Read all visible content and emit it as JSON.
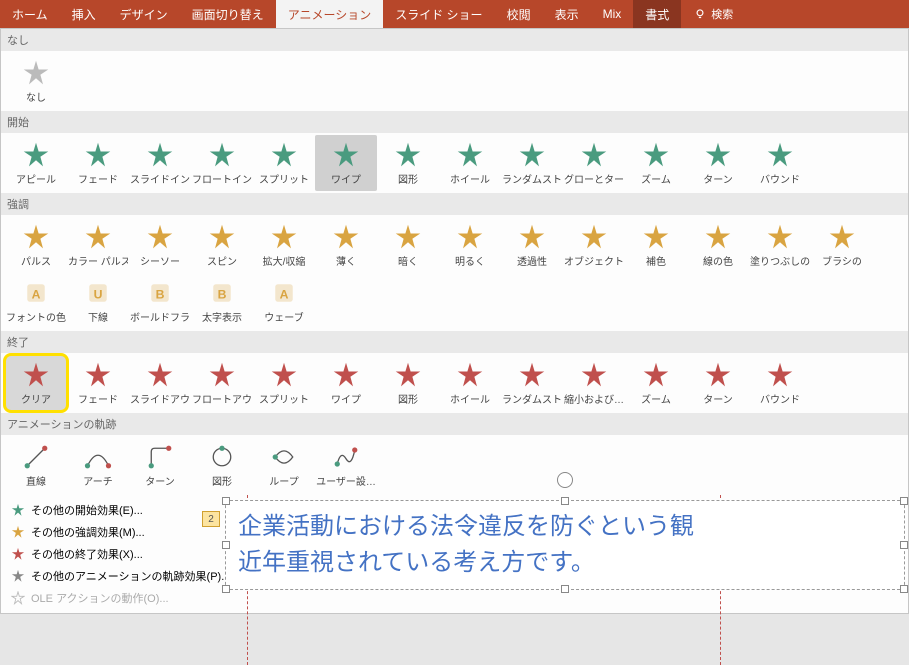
{
  "ribbon": {
    "tabs": [
      "ホーム",
      "挿入",
      "デザイン",
      "画面切り替え",
      "アニメーション",
      "スライド ショー",
      "校閲",
      "表示",
      "Mix",
      "書式"
    ],
    "active": "アニメーション",
    "dark": "書式",
    "search": "検索"
  },
  "sections": {
    "none": {
      "label": "なし",
      "items": [
        {
          "label": "なし",
          "color": "#bbb"
        }
      ]
    },
    "entrance": {
      "label": "開始",
      "items": [
        {
          "label": "アピール",
          "color": "#4a9b7f"
        },
        {
          "label": "フェード",
          "color": "#4a9b7f"
        },
        {
          "label": "スライドイン",
          "color": "#4a9b7f"
        },
        {
          "label": "フロートイン",
          "color": "#4a9b7f"
        },
        {
          "label": "スプリット",
          "color": "#4a9b7f"
        },
        {
          "label": "ワイプ",
          "color": "#4a9b7f",
          "hovered": true
        },
        {
          "label": "図形",
          "color": "#4a9b7f"
        },
        {
          "label": "ホイール",
          "color": "#4a9b7f"
        },
        {
          "label": "ランダムスト…",
          "color": "#4a9b7f"
        },
        {
          "label": "グローとターン",
          "color": "#4a9b7f"
        },
        {
          "label": "ズーム",
          "color": "#4a9b7f"
        },
        {
          "label": "ターン",
          "color": "#4a9b7f"
        },
        {
          "label": "バウンド",
          "color": "#4a9b7f"
        }
      ]
    },
    "emphasis": {
      "label": "強調",
      "items": [
        {
          "label": "パルス",
          "color": "#d9a441"
        },
        {
          "label": "カラー パルス",
          "color": "#d9a441"
        },
        {
          "label": "シーソー",
          "color": "#d9a441"
        },
        {
          "label": "スピン",
          "color": "#d9a441"
        },
        {
          "label": "拡大/収縮",
          "color": "#d9a441"
        },
        {
          "label": "薄く",
          "color": "#d9a441"
        },
        {
          "label": "暗く",
          "color": "#d9a441"
        },
        {
          "label": "明るく",
          "color": "#d9a441"
        },
        {
          "label": "透過性",
          "color": "#d9a441"
        },
        {
          "label": "オブジェクト …",
          "color": "#d9a441"
        },
        {
          "label": "補色",
          "color": "#d9a441"
        },
        {
          "label": "線の色",
          "color": "#d9a441"
        },
        {
          "label": "塗りつぶしの色",
          "color": "#d9a441"
        },
        {
          "label": "ブラシの",
          "color": "#d9a441"
        },
        {
          "label": "フォントの色",
          "color": "#d9a441",
          "letter": "A"
        },
        {
          "label": "下線",
          "color": "#d9a441",
          "letter": "U"
        },
        {
          "label": "ボールドフラ…",
          "color": "#d9a441",
          "letter": "B"
        },
        {
          "label": "太字表示",
          "color": "#d9a441",
          "letter": "B"
        },
        {
          "label": "ウェーブ",
          "color": "#d9a441",
          "letter": "A"
        }
      ]
    },
    "exit": {
      "label": "終了",
      "items": [
        {
          "label": "クリア",
          "color": "#c0504d",
          "highlighted": true
        },
        {
          "label": "フェード",
          "color": "#c0504d"
        },
        {
          "label": "スライドアウト",
          "color": "#c0504d"
        },
        {
          "label": "フロートアウト",
          "color": "#c0504d"
        },
        {
          "label": "スプリット",
          "color": "#c0504d"
        },
        {
          "label": "ワイプ",
          "color": "#c0504d"
        },
        {
          "label": "図形",
          "color": "#c0504d"
        },
        {
          "label": "ホイール",
          "color": "#c0504d"
        },
        {
          "label": "ランダムスト…",
          "color": "#c0504d"
        },
        {
          "label": "縮小および…",
          "color": "#c0504d"
        },
        {
          "label": "ズーム",
          "color": "#c0504d"
        },
        {
          "label": "ターン",
          "color": "#c0504d"
        },
        {
          "label": "バウンド",
          "color": "#c0504d"
        }
      ]
    },
    "motion": {
      "label": "アニメーションの軌跡",
      "items": [
        {
          "label": "直線",
          "shape": "line"
        },
        {
          "label": "アーチ",
          "shape": "arc"
        },
        {
          "label": "ターン",
          "shape": "turn"
        },
        {
          "label": "図形",
          "shape": "circle"
        },
        {
          "label": "ループ",
          "shape": "loop"
        },
        {
          "label": "ユーザー設…",
          "shape": "custom"
        }
      ]
    }
  },
  "more": [
    {
      "label": "その他の開始効果(E)...",
      "color": "#4a9b7f"
    },
    {
      "label": "その他の強調効果(M)...",
      "color": "#d9a441"
    },
    {
      "label": "その他の終了効果(X)...",
      "color": "#c0504d"
    },
    {
      "label": "その他のアニメーションの軌跡効果(P)...",
      "color": "#888"
    },
    {
      "label": "OLE アクションの動作(O)...",
      "disabled": true
    }
  ],
  "slide": {
    "text": "企業活動における法令違反を防ぐという観\n近年重視されている考え方です。",
    "anim_tag": "2"
  }
}
